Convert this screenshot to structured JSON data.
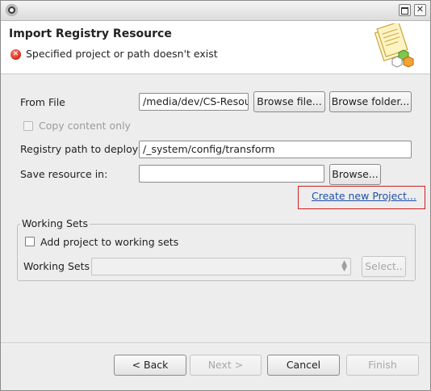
{
  "dialog": {
    "title": "Import Registry Resource",
    "error_message": "Specified project or path doesn't exist"
  },
  "form": {
    "from_file_label": "From File",
    "from_file_value": "/media/dev/CS-Resour",
    "browse_file_label": "Browse file...",
    "browse_folder_label": "Browse folder...",
    "copy_content_label": "Copy content only",
    "registry_path_label": "Registry path to deploy",
    "registry_path_value": "/_system/config/transform",
    "save_resource_label": "Save resource in:",
    "save_resource_value": "",
    "browse_label": "Browse...",
    "create_project_link": "Create new Project..."
  },
  "working_sets": {
    "group_title": "Working Sets",
    "add_checkbox_label": "Add project to working sets",
    "combo_label": "Working Sets",
    "combo_value": "",
    "select_label": "Select.."
  },
  "buttons": {
    "back": "< Back",
    "next": "Next >",
    "cancel": "Cancel",
    "finish": "Finish"
  },
  "colors": {
    "link": "#1f4fa8",
    "highlight_border": "#d21f1f",
    "error_icon": "#d92c1c"
  }
}
